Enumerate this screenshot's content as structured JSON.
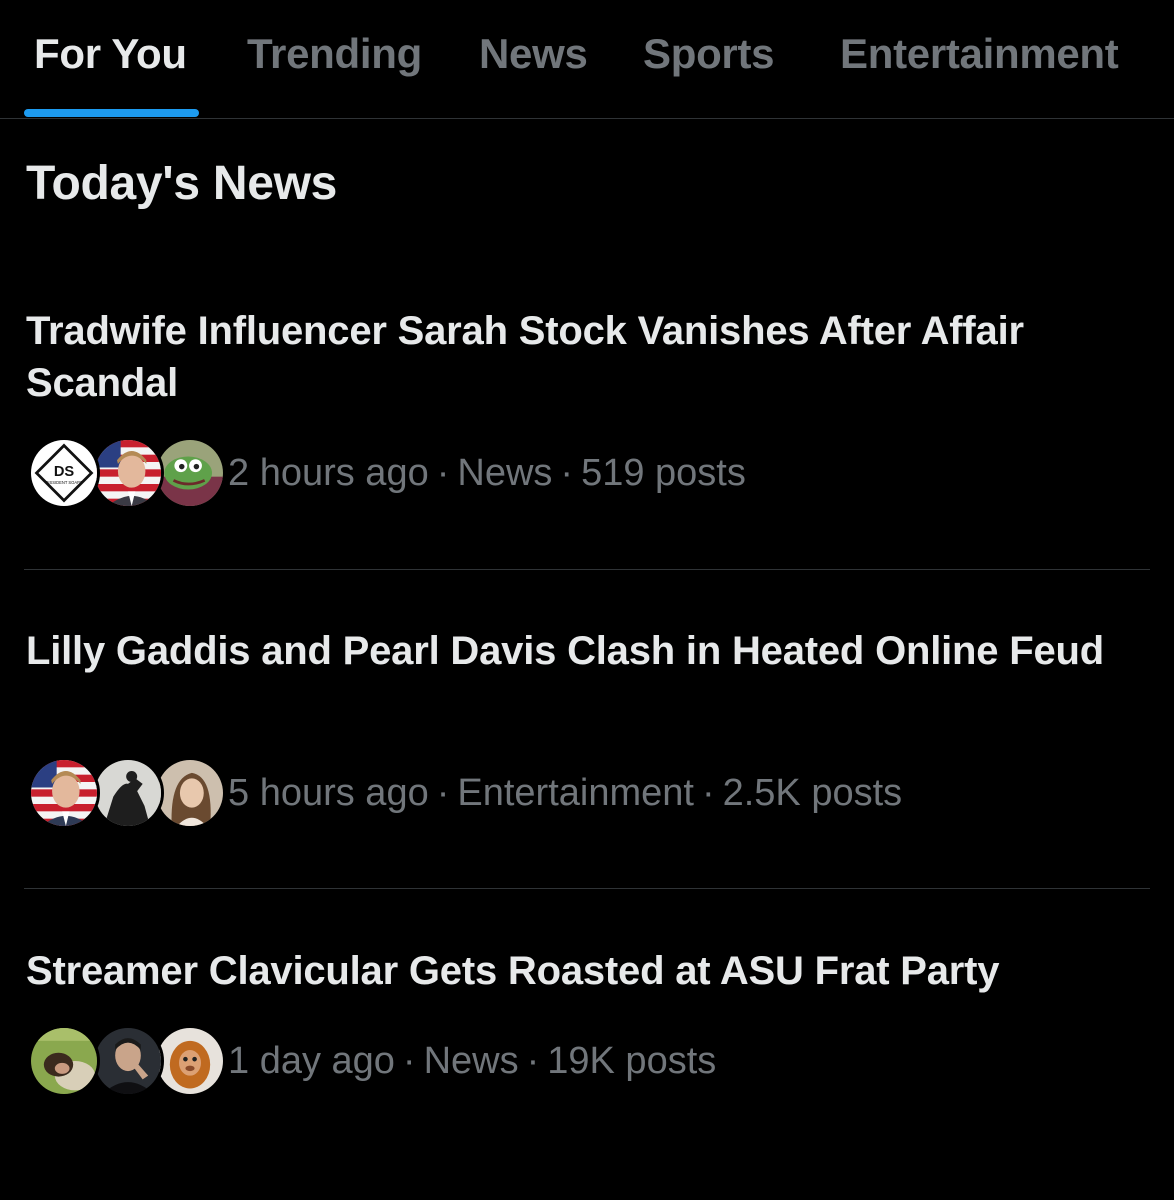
{
  "tabs": [
    {
      "label": "For You",
      "active": true
    },
    {
      "label": "Trending",
      "active": false
    },
    {
      "label": "News",
      "active": false
    },
    {
      "label": "Sports",
      "active": false
    },
    {
      "label": "Entertainment",
      "active": false
    }
  ],
  "accent_color": "#1d9bf0",
  "section_title": "Today's News",
  "items": [
    {
      "headline": "Tradwife Influencer Sarah Stock Vanishes After Affair Scandal",
      "time": "2 hours ago",
      "category": "News",
      "posts": "519 posts",
      "avatars": [
        {
          "icon": "dissident-soaps-logo-avatar",
          "logo_text": "DS",
          "logo_subtext": "DISSIDENT SOAPS"
        },
        {
          "icon": "man-flag-avatar"
        },
        {
          "icon": "pepe-frog-avatar"
        }
      ]
    },
    {
      "headline": "Lilly Gaddis and Pearl Davis Clash in Heated Online Feud",
      "time": "5 hours ago",
      "category": "Entertainment",
      "posts": "2.5K posts",
      "avatars": [
        {
          "icon": "man-flag-avatar"
        },
        {
          "icon": "statue-avatar"
        },
        {
          "icon": "woman-portrait-avatar"
        }
      ]
    },
    {
      "headline": "Streamer Clavicular Gets Roasted at ASU Frat Party",
      "time": "1 day ago",
      "category": "News",
      "posts": "19K posts",
      "avatars": [
        {
          "icon": "grass-photo-avatar"
        },
        {
          "icon": "man-dark-avatar"
        },
        {
          "icon": "monkey-avatar"
        }
      ]
    }
  ]
}
